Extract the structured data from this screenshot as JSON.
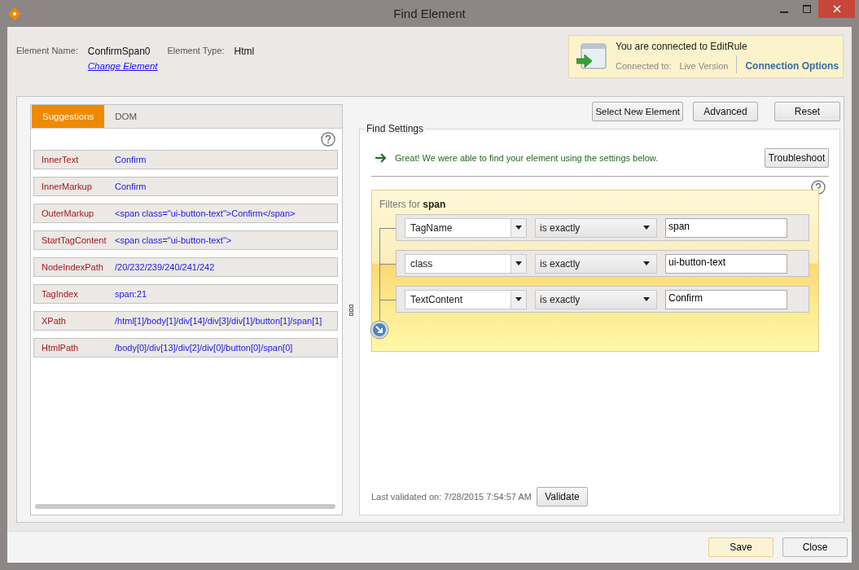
{
  "window": {
    "title": "Find Element"
  },
  "element": {
    "name_label": "Element Name:",
    "name": "ConfirmSpan0",
    "change_link": "Change Element",
    "type_label": "Element Type:",
    "type": "Html"
  },
  "connection": {
    "message": "You are connected to EditRule",
    "connected_label": "Connected to:",
    "version": "Live Version",
    "options_link": "Connection Options"
  },
  "tabs": [
    {
      "label": "Suggestions",
      "selected": true
    },
    {
      "label": "DOM",
      "selected": false
    }
  ],
  "suggestions": [
    {
      "name": "InnerText",
      "value": "Confirm"
    },
    {
      "name": "InnerMarkup",
      "value": "Confirm"
    },
    {
      "name": "OuterMarkup",
      "value": "<span class=\"ui-button-text\">Confirm</span>"
    },
    {
      "name": "StartTagContent",
      "value": "<span class=\"ui-button-text\">"
    },
    {
      "name": "NodeIndexPath",
      "value": "/20/232/239/240/241/242"
    },
    {
      "name": "TagIndex",
      "value": "span:21"
    },
    {
      "name": "XPath",
      "value": "/html[1]/body[1]/div[14]/div[3]/div[1]/button[1]/span[1]"
    },
    {
      "name": "HtmlPath",
      "value": "/body[0]/div[13]/div[2]/div[0]/button[0]/span[0]"
    }
  ],
  "toolbar": [
    "Select New Element",
    "Advanced",
    "Reset"
  ],
  "find_settings": {
    "title": "Find Settings",
    "status": "Great! We were able to find your element using the settings below.",
    "troubleshoot": "Troubleshoot",
    "filters_title": "Filters for **span**",
    "filters": [
      {
        "attribute": "TagName",
        "operator": "is exactly",
        "value": "span"
      },
      {
        "attribute": "class",
        "operator": "is exactly",
        "value": "ui-button-text"
      },
      {
        "attribute": "TextContent",
        "operator": "is exactly",
        "value": "Confirm"
      }
    ],
    "last_validated": "Last validated on: 7/28/2015 7:54:57 AM",
    "validate": "Validate"
  },
  "footer": {
    "buttons": [
      {
        "label": "Save",
        "default": true
      },
      {
        "label": "Close",
        "default": false
      }
    ]
  }
}
